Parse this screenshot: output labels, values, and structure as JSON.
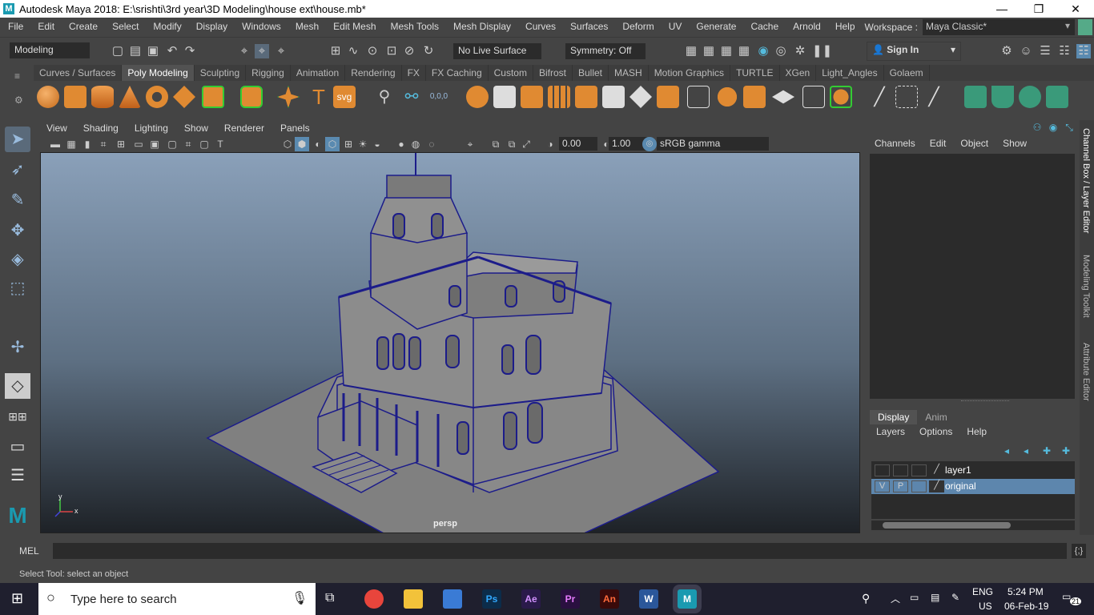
{
  "window": {
    "title": "Autodesk Maya 2018: E:\\srishti\\3rd year\\3D Modeling\\house ext\\house.mb*",
    "app_icon": "M",
    "minimize": "—",
    "restore": "❐",
    "close": "✕"
  },
  "menubar": {
    "items": [
      "File",
      "Edit",
      "Create",
      "Select",
      "Modify",
      "Display",
      "Windows",
      "Mesh",
      "Edit Mesh",
      "Mesh Tools",
      "Mesh Display",
      "Curves",
      "Surfaces",
      "Deform",
      "UV",
      "Generate",
      "Cache",
      "Arnold",
      "Help"
    ]
  },
  "workspace": {
    "label": "Workspace :",
    "value": "Maya Classic*"
  },
  "statusline": {
    "mode": "Modeling",
    "live_surface": "No Live Surface",
    "symmetry": "Symmetry: Off",
    "sign_in": "Sign In"
  },
  "shelf": {
    "tabs": [
      "Curves / Surfaces",
      "Poly Modeling",
      "Sculpting",
      "Rigging",
      "Animation",
      "Rendering",
      "FX",
      "FX Caching",
      "Custom",
      "Bifrost",
      "Bullet",
      "MASH",
      "Motion Graphics",
      "TURTLE",
      "XGen",
      "Light_Angles",
      "Golaem"
    ],
    "active_tab": "Poly Modeling",
    "svg_label": "svg",
    "numeric_label": "0,0,0",
    "text_tool": "T"
  },
  "viewport": {
    "menu": [
      "View",
      "Shading",
      "Lighting",
      "Show",
      "Renderer",
      "Panels"
    ],
    "exposure": "0.00",
    "gamma": "1.00",
    "color_space": "sRGB gamma",
    "camera_label": "persp",
    "axis_y": "y",
    "axis_x": "x"
  },
  "channel_box": {
    "menu": [
      "Channels",
      "Edit",
      "Object",
      "Show"
    ]
  },
  "layer_editor": {
    "tabs": [
      "Display",
      "Anim"
    ],
    "active_tab": "Display",
    "menu": [
      "Layers",
      "Options",
      "Help"
    ],
    "layers": [
      {
        "name": "layer1",
        "v": "",
        "p": ""
      },
      {
        "name": "original",
        "v": "V",
        "p": "P"
      }
    ]
  },
  "right_vtabs": [
    "Channel Box / Layer Editor",
    "Modeling Toolkit",
    "Attribute Editor"
  ],
  "mel": {
    "label": "MEL"
  },
  "help_line": {
    "text": "Select Tool: select an object"
  },
  "taskbar": {
    "search_placeholder": "Type here to search",
    "apps": [
      {
        "name": "chrome",
        "label": "",
        "color": "#e8453c"
      },
      {
        "name": "file-explorer",
        "label": "",
        "color": "#f2c23a"
      },
      {
        "name": "store",
        "label": "",
        "color": "#3a7bd5"
      },
      {
        "name": "photoshop",
        "label": "Ps",
        "color": "#0c2c4a"
      },
      {
        "name": "after-effects",
        "label": "Ae",
        "color": "#2a1a4a"
      },
      {
        "name": "premiere",
        "label": "Pr",
        "color": "#2a1040"
      },
      {
        "name": "animate",
        "label": "An",
        "color": "#3a0a0a"
      },
      {
        "name": "word",
        "label": "W",
        "color": "#2b579a"
      },
      {
        "name": "maya",
        "label": "M",
        "color": "#1a9ab0"
      }
    ],
    "lang": "ENG",
    "region": "US",
    "time": "5:24 PM",
    "date": "06-Feb-19",
    "notifications": "21"
  }
}
